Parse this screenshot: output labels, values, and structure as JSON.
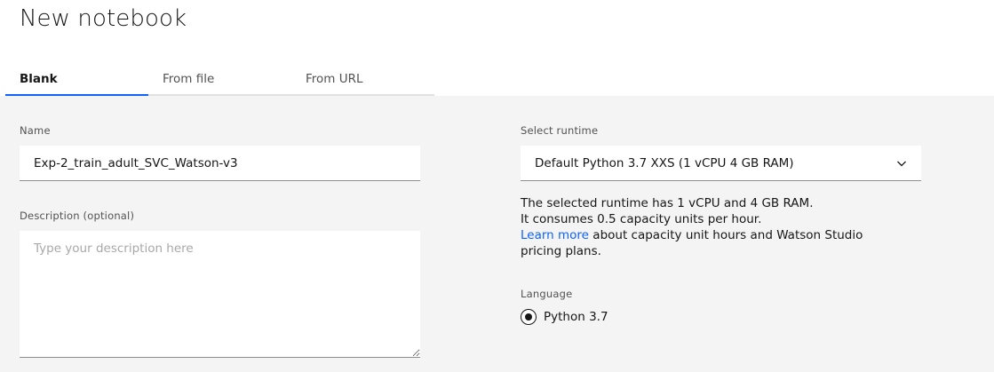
{
  "page": {
    "title": "New notebook"
  },
  "tabs": [
    {
      "label": "Blank",
      "active": true
    },
    {
      "label": "From file",
      "active": false
    },
    {
      "label": "From URL",
      "active": false
    }
  ],
  "form": {
    "name_label": "Name",
    "name_value": "Exp-2_train_adult_SVC_Watson-v3",
    "description_label": "Description (optional)",
    "description_placeholder": "Type your description here",
    "runtime_label": "Select runtime",
    "runtime_selected": "Default Python 3.7 XXS (1 vCPU 4 GB RAM)",
    "runtime_info_line1": "The selected runtime has 1 vCPU and 4 GB RAM.",
    "runtime_info_line2": "It consumes 0.5 capacity units per hour.",
    "learn_more_link": "Learn more",
    "learn_more_suffix": " about capacity unit hours and Watson Studio pricing plans.",
    "language_label": "Language",
    "language_option": "Python 3.7",
    "language_selected": true
  },
  "colors": {
    "accent": "#0f62fe",
    "background": "#f4f4f4",
    "text": "#161616"
  },
  "icons": {
    "dropdown": "chevron-down-icon"
  }
}
